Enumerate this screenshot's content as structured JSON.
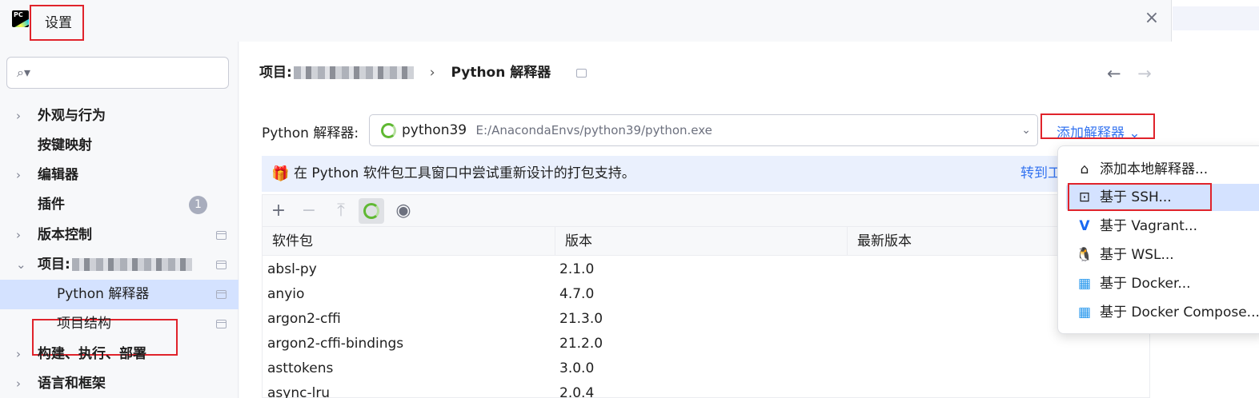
{
  "window": {
    "title": "设置",
    "close": "×"
  },
  "search": {
    "placeholder": ""
  },
  "sidebar": {
    "items": [
      {
        "label": "外观与行为",
        "chev": "›"
      },
      {
        "label": "按键映射"
      },
      {
        "label": "编辑器",
        "chev": "›"
      },
      {
        "label": "插件",
        "badge": "1"
      },
      {
        "label": "版本控制",
        "chev": "›"
      },
      {
        "label": "项目:",
        "chev": "⌄"
      },
      {
        "label": "Python 解释器"
      },
      {
        "label": "项目结构"
      },
      {
        "label": "构建、执行、部署",
        "chev": "›"
      },
      {
        "label": "语言和框架",
        "chev": "›"
      }
    ]
  },
  "breadcrumb": {
    "project": "项目:",
    "sep": "›",
    "page": "Python 解释器"
  },
  "nav": {
    "back": "←",
    "forward": "→"
  },
  "interpreter": {
    "label": "Python 解释器:",
    "name": "python39",
    "path": "E:/AnacondaEnvs/python39/python.exe",
    "add_label": "添加解释器 ⌄"
  },
  "banner": {
    "text": "在 Python 软件包工具窗口中尝试重新设计的打包支持。",
    "link": "转到工"
  },
  "toolbar": {
    "add": "+",
    "remove": "−",
    "upgrade": "⤒",
    "show": "◉"
  },
  "table": {
    "headers": [
      "软件包",
      "版本",
      "最新版本"
    ],
    "rows": [
      {
        "name": "absl-py",
        "version": "2.1.0"
      },
      {
        "name": "anyio",
        "version": "4.7.0"
      },
      {
        "name": "argon2-cffi",
        "version": "21.3.0"
      },
      {
        "name": "argon2-cffi-bindings",
        "version": "21.2.0"
      },
      {
        "name": "asttokens",
        "version": "3.0.0"
      },
      {
        "name": "async-lru",
        "version": "2.0.4"
      }
    ]
  },
  "menu": {
    "items": [
      {
        "label": "添加本地解释器...",
        "icon": "⌂"
      },
      {
        "label": "基于 SSH...",
        "icon": "⊡"
      },
      {
        "label": "基于 Vagrant...",
        "icon": "V"
      },
      {
        "label": "基于 WSL...",
        "icon": "🐧"
      },
      {
        "label": "基于 Docker...",
        "icon": "▦"
      },
      {
        "label": "基于 Docker Compose...",
        "icon": "▦"
      }
    ]
  }
}
